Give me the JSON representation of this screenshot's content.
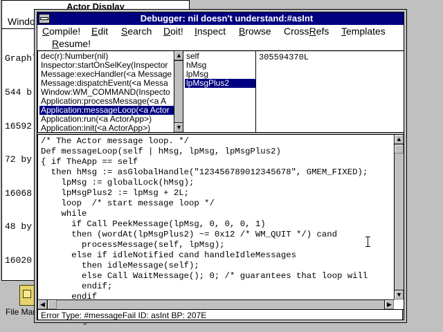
{
  "background_window": {
    "title": "Actor Display",
    "menu": "Windows",
    "lines": [
      "Graphl",
      "544 b",
      "16592",
      "72 by",
      "16068",
      "48 by",
      "16020"
    ]
  },
  "desktop": {
    "icon_label": "File Manager",
    "icon_label_fragment": "Manager"
  },
  "debugger": {
    "title": "Debugger: nil doesn't understand:#asInt",
    "menu": [
      {
        "label": "Compile!",
        "u": "C"
      },
      {
        "label": "Edit",
        "u": "E"
      },
      {
        "label": "Search",
        "u": "S"
      },
      {
        "label": "Doit!",
        "u": "D"
      },
      {
        "label": "Inspect",
        "u": "I"
      },
      {
        "label": "Browse",
        "u": "B"
      },
      {
        "label": "CrossRefs",
        "u": "R"
      },
      {
        "label": "Templates",
        "u": "T"
      },
      {
        "label": "Resume!",
        "u": "R"
      }
    ],
    "stack": [
      "dec(r):Number(nil)",
      "Inspector:startOnSelKey(Inspector",
      "Message:execHandler(<a Message",
      "Message:dispatchEvent(<a Messa",
      "Window:WM_COMMAND(Inspecto",
      "Application:processMessage(<a A",
      "Application:messageLoop(<a Actor",
      "Application:run(<a ActorApp>)",
      "Application:init(<a ActorApp>)"
    ],
    "stack_selected_index": 6,
    "variables": [
      "self",
      "hMsg",
      "lpMsg",
      "lpMsgPlus2"
    ],
    "variables_selected_index": 3,
    "value": "305594370L",
    "code": [
      "/* The Actor message loop. */",
      "Def messageLoop(self | hMsg, lpMsg, lpMsgPlus2)",
      "{ if TheApp == self",
      "  then hMsg := asGlobalHandle(\"123456789012345678\", GMEM_FIXED);",
      "    lpMsg := globalLock(hMsg);",
      "    lpMsgPlus2 := lpMsg + 2L;",
      "    loop  /* start message loop */",
      "    while",
      "      if Call PeekMessage(lpMsg, 0, 0, 0, 1)",
      "      then (wordAt(lpMsgPlus2) ~= 0x12 /* WM_QUIT */) cand",
      "        processMessage(self, lpMsg);",
      "      else if idleNotified cand handleIdleMessages",
      "        then idleMessage(self);",
      "        else Call WaitMessage(); 0; /* guarantees that loop will",
      "        endif;",
      "      endif"
    ],
    "status": "Error Type: #messageFail  ID: asInt  BP: 207E"
  }
}
